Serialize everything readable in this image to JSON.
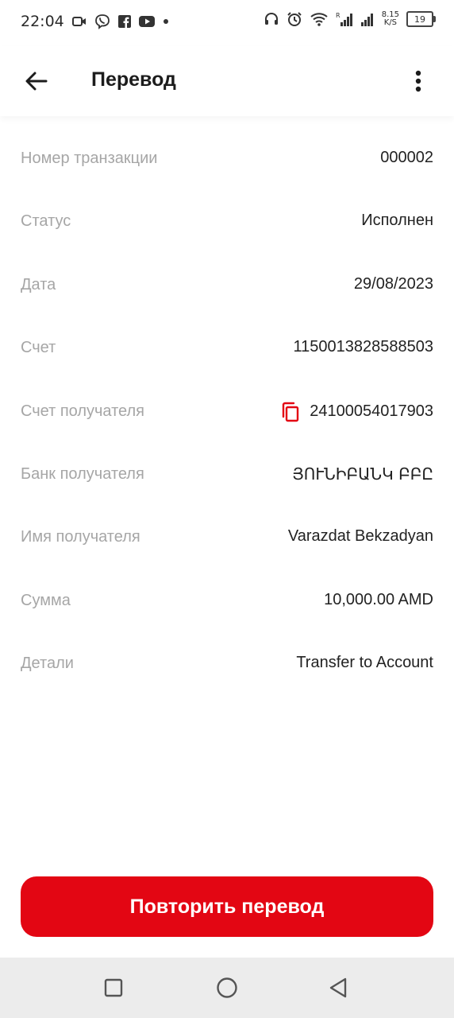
{
  "status_bar": {
    "time": "22:04",
    "icons_left": [
      "video-call-icon",
      "viber-icon",
      "facebook-icon",
      "youtube-icon",
      "dot-icon"
    ],
    "icons_right": [
      "headset-icon",
      "alarm-icon",
      "wifi-icon",
      "signal-r-icon",
      "signal-icon"
    ],
    "net_speed_value": "8.15",
    "net_speed_unit": "K/S",
    "battery": "19"
  },
  "header": {
    "title": "Перевод"
  },
  "details": [
    {
      "label": "Номер транзакции",
      "value": "000002"
    },
    {
      "label": "Статус",
      "value": "Исполнен"
    },
    {
      "label": "Дата",
      "value": "29/08/2023"
    },
    {
      "label": "Счет",
      "value": "1150013828588503"
    },
    {
      "label": "Счет получателя",
      "value": "24100054017903"
    },
    {
      "label": "Банк получателя",
      "value": "ՅՈՒՆԻԲԱՆԿ ԲԲԸ"
    },
    {
      "label": "Имя получателя",
      "value": "Varazdat Bekzadyan"
    },
    {
      "label": "Сумма",
      "value": "10,000.00 AMD"
    },
    {
      "label": "Детали",
      "value": "Transfer to Account"
    }
  ],
  "action": {
    "repeat_label": "Повторить перевод"
  },
  "colors": {
    "accent": "#e30613",
    "label": "#a6a6a6",
    "value": "#222222",
    "nav_bg": "#ececec"
  }
}
